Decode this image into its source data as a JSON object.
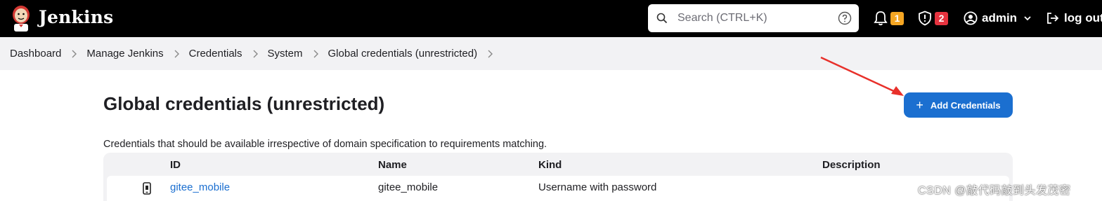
{
  "header": {
    "brand": "Jenkins",
    "search_placeholder": "Search (CTRL+K)",
    "notifications_count": "1",
    "security_count": "2",
    "user": "admin",
    "logout": "log out",
    "colors": {
      "bar": "#000000",
      "notif_badge": "#f5a623",
      "security_badge": "#e6333f"
    }
  },
  "breadcrumb": [
    "Dashboard",
    "Manage Jenkins",
    "Credentials",
    "System",
    "Global credentials (unrestricted)"
  ],
  "main": {
    "title": "Global credentials (unrestricted)",
    "add_button": "Add Credentials",
    "description": "Credentials that should be available irrespective of domain specification to requirements matching.",
    "table": {
      "headers": [
        "ID",
        "Name",
        "Kind",
        "Description"
      ],
      "rows": [
        {
          "id": "gitee_mobile",
          "name": "gitee_mobile",
          "kind": "Username with password",
          "description": ""
        }
      ]
    }
  },
  "watermark": "CSDN @敲代码敲到头发茂密",
  "icons": [
    "jenkins-logo",
    "search-icon",
    "help-icon",
    "bell-icon",
    "shield-icon",
    "user-icon",
    "chevron-down-icon",
    "logout-icon",
    "chevron-right-icon",
    "plus-icon",
    "phone-icon"
  ],
  "accent_color": "#1b6fd0"
}
